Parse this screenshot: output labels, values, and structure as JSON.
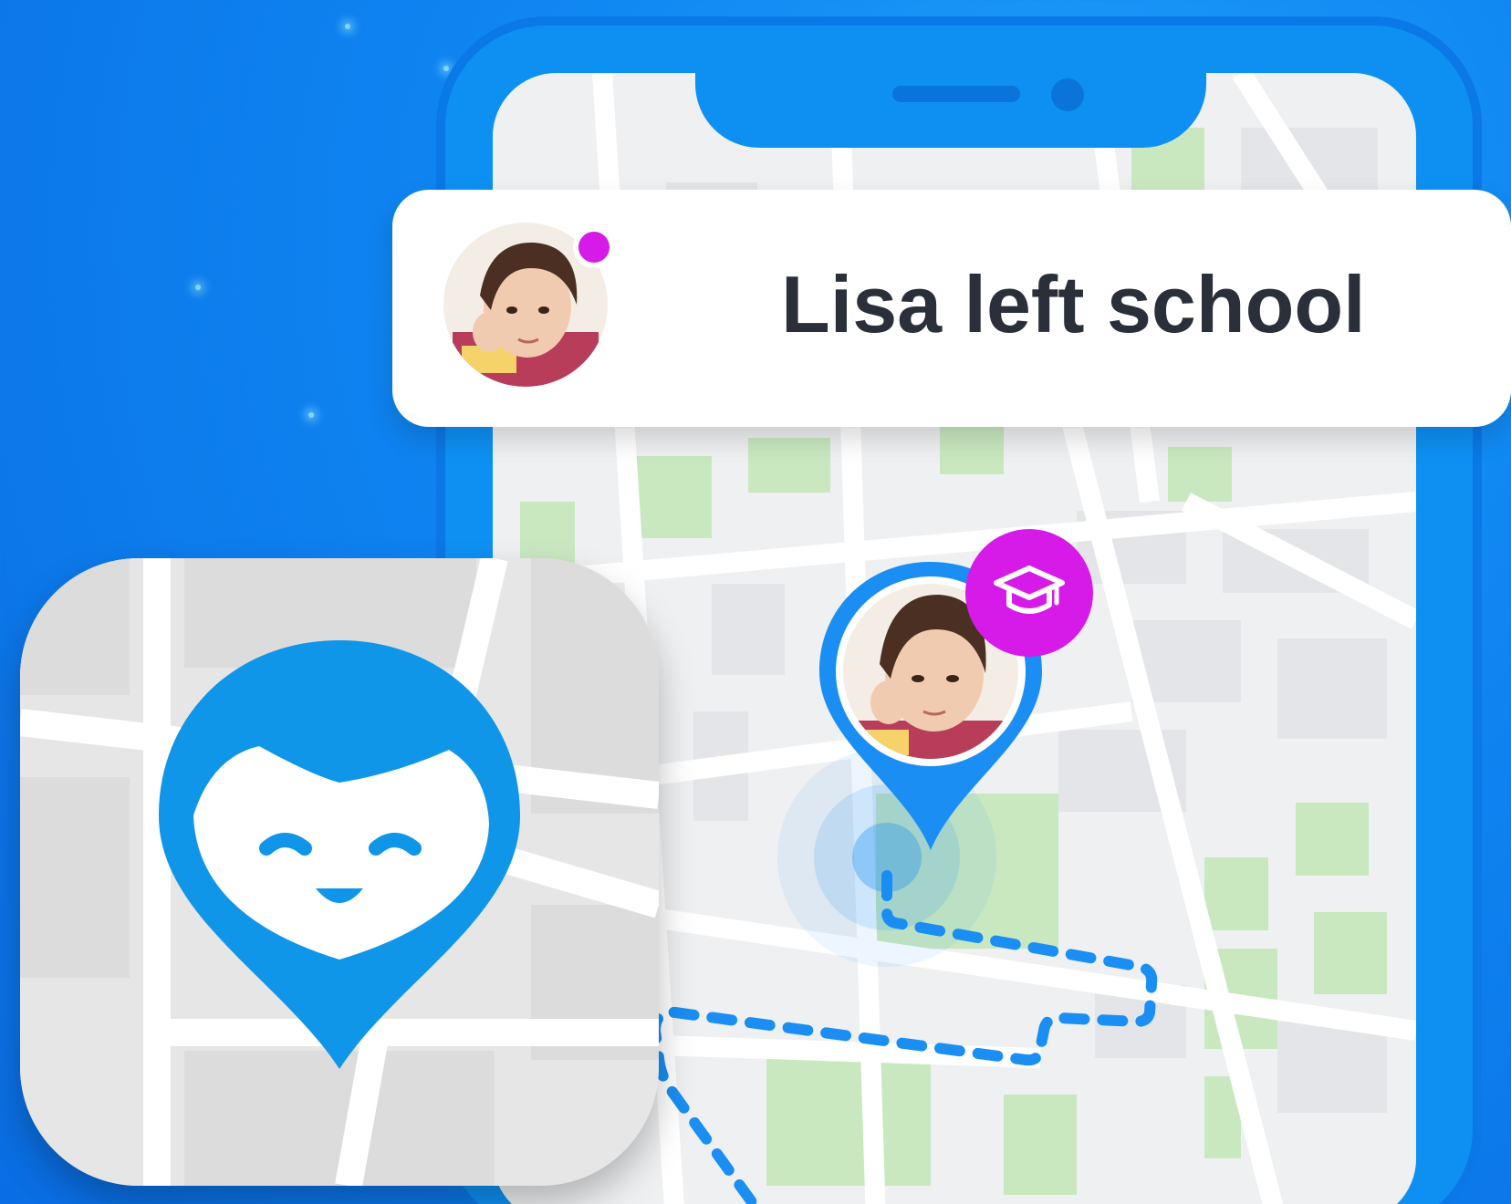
{
  "notification": {
    "message": "Lisa left school",
    "avatar_icon": "child-avatar",
    "status_color": "#d61be8"
  },
  "map": {
    "pin_icon": "location-pin-avatar",
    "badge_icon": "graduation-cap-icon",
    "route_color": "#1a8ef2"
  },
  "app_icon": {
    "name": "app-logo-icon",
    "brand_color": "#0f96e8"
  }
}
